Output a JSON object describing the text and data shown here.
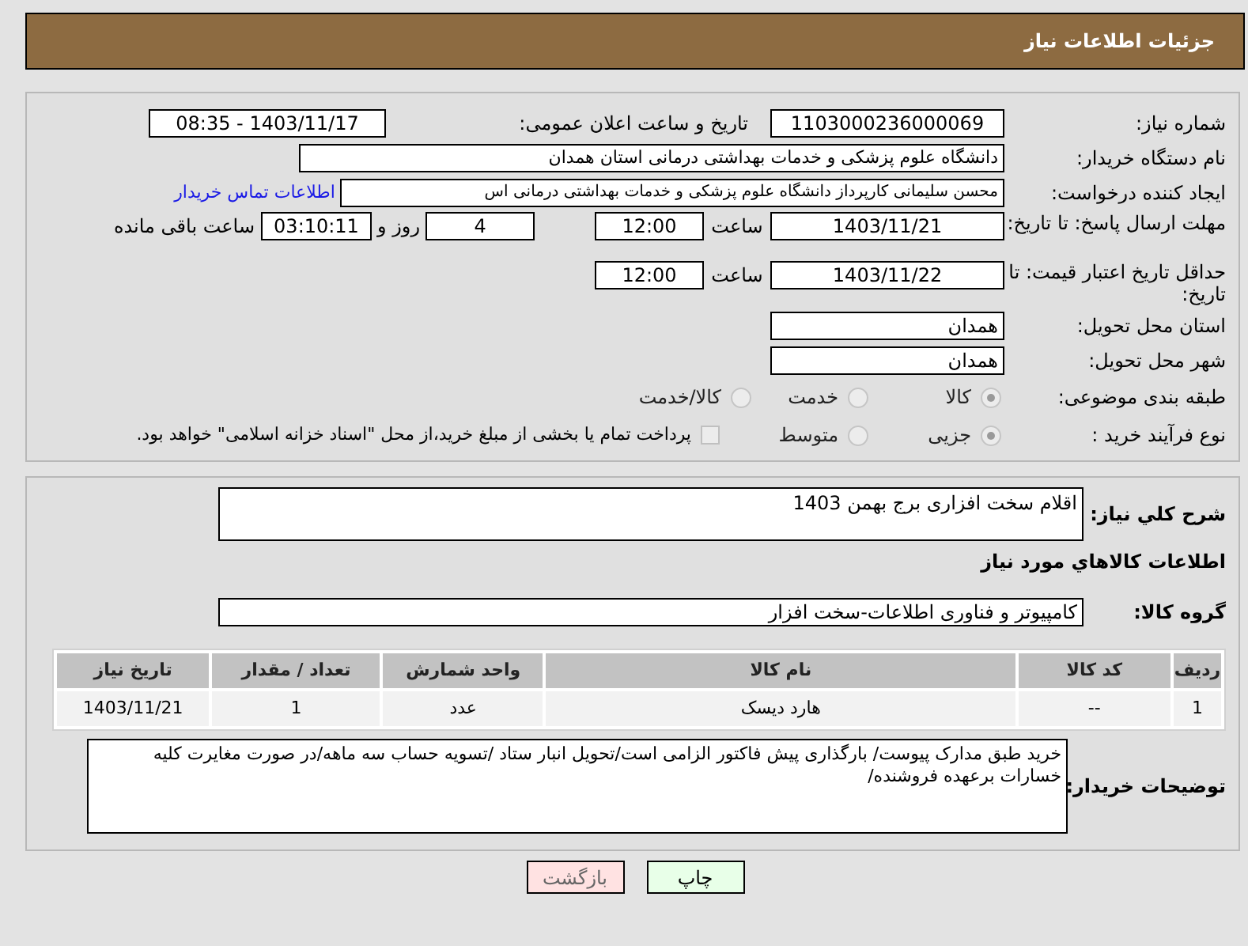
{
  "header": {
    "title": "جزئیات اطلاعات نیاز"
  },
  "need_number": {
    "label": "شماره نیاز:",
    "value": "1103000236000069"
  },
  "announce": {
    "label": "تاریخ و ساعت اعلان عمومی:",
    "value": "1403/11/17 - 08:35"
  },
  "buyer_org": {
    "label": "نام دستگاه خریدار:",
    "value": "دانشگاه علوم پزشکی و خدمات بهداشتی درمانی استان همدان"
  },
  "requester": {
    "label": "ایجاد کننده درخواست:",
    "value": "محسن سلیمانی کارپرداز دانشگاه علوم پزشکی و خدمات بهداشتی درمانی اس",
    "link": "اطلاعات تماس خریدار"
  },
  "reply_deadline": {
    "label": "مهلت ارسال پاسخ: تا تاریخ:",
    "date": "1403/11/21",
    "time_label": "ساعت",
    "time": "12:00",
    "days": "4",
    "days_label": "روز و",
    "remaining": "03:10:11",
    "remaining_label": "ساعت باقی مانده"
  },
  "price_validity": {
    "label": "حداقل تاریخ اعتبار قیمت: تا تاریخ:",
    "date": "1403/11/22",
    "time_label": "ساعت",
    "time": "12:00"
  },
  "province": {
    "label": "استان محل تحویل:",
    "value": "همدان"
  },
  "city": {
    "label": "شهر محل تحویل:",
    "value": "همدان"
  },
  "category": {
    "label": "طبقه بندی موضوعی:",
    "options": [
      {
        "label": "کالا",
        "selected": true
      },
      {
        "label": "خدمت",
        "selected": false
      },
      {
        "label": "کالا/خدمت",
        "selected": false
      }
    ]
  },
  "purchase_type": {
    "label": "نوع فرآیند خرید :",
    "options": [
      {
        "label": "جزیی",
        "selected": true
      },
      {
        "label": "متوسط",
        "selected": false
      }
    ],
    "checkbox": {
      "label": "پرداخت تمام یا بخشی از مبلغ خرید،از محل \"اسناد خزانه اسلامی\" خواهد بود.",
      "checked": false
    }
  },
  "description": {
    "label": "شرح کلي نياز:",
    "value": "اقلام سخت افزاری برج بهمن 1403"
  },
  "goods_heading": "اطلاعات کالاهاي مورد نياز",
  "goods_group": {
    "label": "گروه کالا:",
    "value": "کامپیوتر و فناوری اطلاعات-سخت افزار"
  },
  "table": {
    "columns": [
      "ردیف",
      "کد کالا",
      "نام کالا",
      "واحد شمارش",
      "تعداد / مقدار",
      "تاریخ نیاز"
    ],
    "rows": [
      [
        "1",
        "--",
        "هارد دیسک",
        "عدد",
        "1",
        "1403/11/21"
      ]
    ]
  },
  "buyer_notes": {
    "label": "توضیحات خریدار:",
    "value": "خرید طبق مدارک پیوست/ بارگذاری پیش فاکتور الزامی است/تحویل انبار ستاد /تسویه حساب سه ماهه/در صورت مغایرت کلیه خسارات برعهده فروشنده/"
  },
  "buttons": [
    {
      "label": "چاپ",
      "kind": "print"
    },
    {
      "label": "بازگشت",
      "kind": "back"
    }
  ]
}
